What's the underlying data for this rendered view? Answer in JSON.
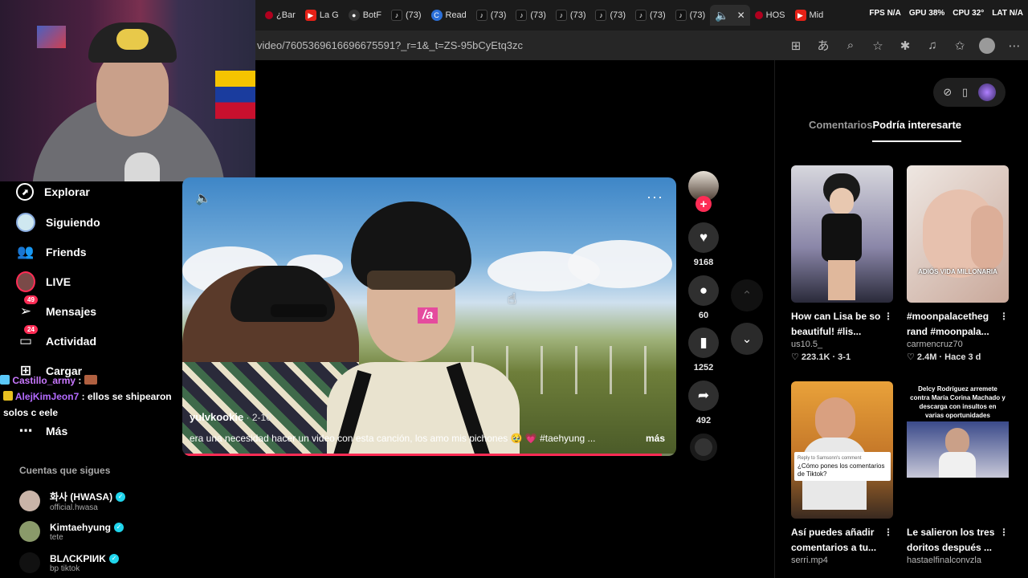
{
  "browser": {
    "tabs": [
      {
        "label": "¿Bar",
        "icon": "dot"
      },
      {
        "label": "La G",
        "icon": "yt"
      },
      {
        "label": "BotF",
        "icon": "gh"
      },
      {
        "label": "(73)",
        "icon": "tt"
      },
      {
        "label": "Read",
        "icon": "bl"
      },
      {
        "label": "(73)",
        "icon": "tt"
      },
      {
        "label": "(73)",
        "icon": "tt"
      },
      {
        "label": "(73)",
        "icon": "tt"
      },
      {
        "label": "(73)",
        "icon": "tt"
      },
      {
        "label": "(73)",
        "icon": "tt"
      },
      {
        "label": "(73)",
        "icon": "tt"
      }
    ],
    "extra_tabs": [
      {
        "label": "HOS",
        "icon": "dot"
      },
      {
        "label": "Mid",
        "icon": "yt"
      }
    ],
    "perf": {
      "fps": "FPS N/A",
      "gpu": "GPU 38%",
      "cpu": "CPU 32°",
      "lat": "LAT N/A"
    },
    "url": "video/7605369616696675591?_r=1&_t=ZS-95bCyEtq3zc"
  },
  "sidebar": {
    "items": [
      {
        "label": "Explorar",
        "icon": "compass-icon",
        "glyph": "⊘"
      },
      {
        "label": "Siguiendo",
        "icon": "following-icon",
        "glyph": ""
      },
      {
        "label": "Friends",
        "icon": "friends-icon",
        "glyph": "👥"
      },
      {
        "label": "LIVE",
        "icon": "live-icon",
        "glyph": ""
      },
      {
        "label": "Mensajes",
        "icon": "messages-icon",
        "glyph": "✈",
        "badge": "49"
      },
      {
        "label": "Actividad",
        "icon": "activity-icon",
        "glyph": "🗨",
        "badge": "24"
      },
      {
        "label": "Cargar",
        "icon": "upload-icon",
        "glyph": "⊞"
      },
      {
        "label": "Más",
        "icon": "more-icon",
        "glyph": "⋯"
      }
    ],
    "following_header": "Cuentas que sigues",
    "accounts": [
      {
        "name": "화사 (HWASA)",
        "handle": "official.hwasa"
      },
      {
        "name": "Kimtaehyung",
        "handle": "tete"
      },
      {
        "name": "BLΛCKPIИK",
        "handle": "bp tiktok"
      }
    ]
  },
  "chat": {
    "msg1_user": "Castillo_army",
    "msg1_sep": " :",
    "msg2_user": "AlejKimJeon7",
    "msg2_text": " : ellos se shipearon solos c eele"
  },
  "video": {
    "sticker": "/a",
    "author": "yulvkookie",
    "date": " · 2-10",
    "description": "era una necesidad hacer un video con esta canción, los amo mis pichones 🥹 💗 #taehyung ...",
    "more": "más",
    "progress": 0.97
  },
  "actions": {
    "likes": "9168",
    "comments": "60",
    "saves": "1252",
    "shares": "492"
  },
  "panel": {
    "tab_comments": "Comentarios",
    "tab_interest": "Podría interesarte",
    "cards": [
      {
        "title": "How can Lisa be so beautiful! #lis...",
        "author": "us10.5_",
        "meta": "♡ 223.1K · 3-1"
      },
      {
        "title": "#moonpalacetheg rand #moonpala...",
        "author": "carmencruz70",
        "meta": "♡ 2.4M · Hace 3 d",
        "caption": "ADIÓS VIDA MILLONARIA"
      },
      {
        "title": "Así puedes añadir comentarios a tu...",
        "author": "serri.mp4",
        "meta": "",
        "bubble_top": "Reply to Samsonn's comment",
        "bubble": "¿Cómo pones los comentarios de Tiktok?"
      },
      {
        "title": "Le salieron los tres doritos después ...",
        "author": "hastaelfinalconvzla",
        "meta": "",
        "news": "Delcy Rodríguez arremete contra María Corina Machado y descarga con insultos en varias oportunidades"
      }
    ]
  }
}
